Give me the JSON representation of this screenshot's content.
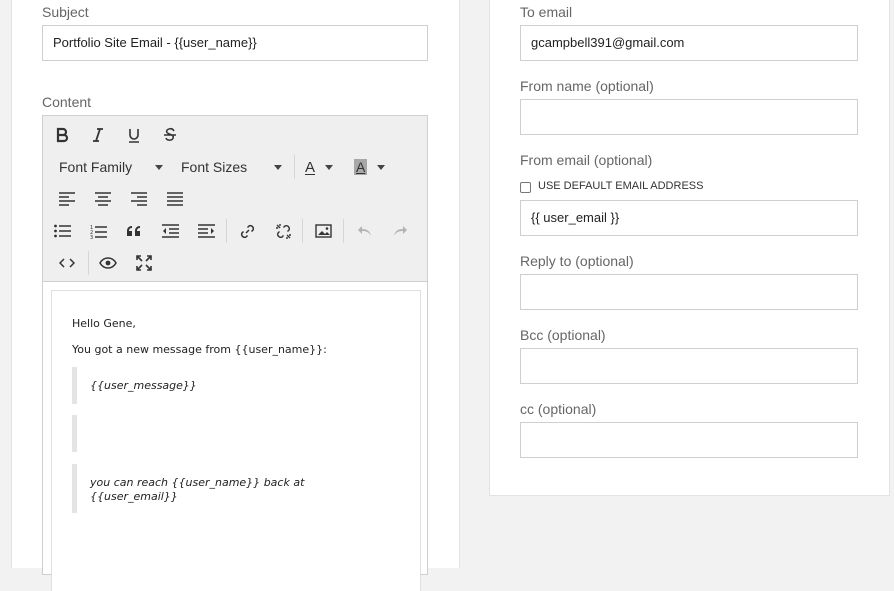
{
  "left": {
    "subject": {
      "label": "Subject",
      "value": "Portfolio Site Email - {{user_name}}"
    },
    "content": {
      "label": "Content"
    },
    "toolbar": {
      "font_family_label": "Font Family",
      "font_sizes_label": "Font Sizes",
      "font_color_glyph": "A",
      "bg_color_glyph": "A",
      "icons": [
        "bold-icon",
        "italic-icon",
        "underline-icon",
        "strikethrough-icon",
        "align-left-icon",
        "align-center-icon",
        "align-right-icon",
        "align-justify-icon",
        "bullet-list-icon",
        "numbered-list-icon",
        "blockquote-icon",
        "outdent-icon",
        "indent-icon",
        "link-icon",
        "unlink-icon",
        "image-icon",
        "undo-icon",
        "redo-icon",
        "code-icon",
        "preview-icon",
        "fullscreen-icon"
      ]
    },
    "document": {
      "greeting": "Hello Gene,",
      "intro": "You got a new message from {{user_name}}:",
      "quote_message": "{{user_message}}",
      "quote_reach_line1": "you can reach {{user_name}} back at",
      "quote_reach_line2": "{{user_email}}"
    }
  },
  "right": {
    "to_email": {
      "label": "To email",
      "value": "gcampbell391@gmail.com"
    },
    "from_name": {
      "label": "From name (optional)",
      "value": ""
    },
    "from_email": {
      "label": "From email (optional)",
      "checkbox_label": "USE DEFAULT EMAIL ADDRESS",
      "checked": false,
      "value": "{{ user_email }}"
    },
    "reply_to": {
      "label": "Reply to (optional)",
      "value": ""
    },
    "bcc": {
      "label": "Bcc (optional)",
      "value": ""
    },
    "cc": {
      "label": "cc (optional)",
      "value": ""
    }
  },
  "colors": {
    "panel_bg": "#ffffff",
    "page_bg": "#f2f2f2",
    "toolbar_bg": "#efefef",
    "border": "#cfcfcf"
  }
}
